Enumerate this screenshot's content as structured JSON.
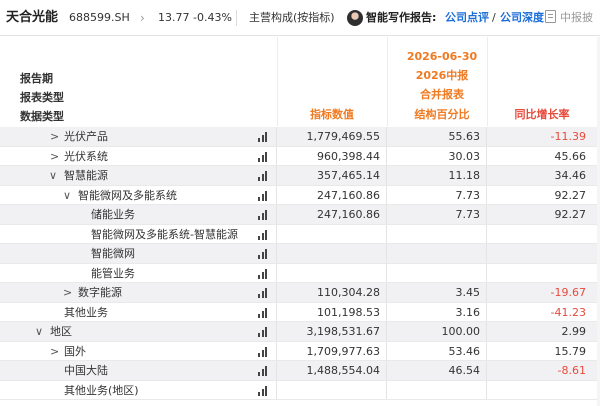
{
  "topbar": {
    "stock_name": "天合光能",
    "stock_code": "688599.SH",
    "chevron": "›",
    "price": "13.77",
    "change": "-0.43%",
    "section": "主营构成(按指标)",
    "ai_label": "智能写作报告:",
    "link1": "公司点评",
    "slash": "/",
    "link2": "公司深度",
    "report": "中报披"
  },
  "header": {
    "labels": [
      "报告期",
      "报表类型",
      "数据类型"
    ],
    "period": "2026-06-30",
    "report_name": "2026中报",
    "report_type": "合并报表",
    "columns": [
      "指标数值",
      "结构百分比",
      "同比增长率"
    ]
  },
  "rows": [
    {
      "label": "光伏产品",
      "chevron": ">",
      "value": "1,779,469.55",
      "pct": "55.63",
      "yoy": "-11.39"
    },
    {
      "label": "光伏系统",
      "chevron": ">",
      "value": "960,398.44",
      "pct": "30.03",
      "yoy": "45.66"
    },
    {
      "label": "智慧能源",
      "chevron": "∨",
      "value": "357,465.14",
      "pct": "11.18",
      "yoy": "34.46"
    },
    {
      "label": "智能微网及多能系统",
      "chevron": "∨",
      "value": "247,160.86",
      "pct": "7.73",
      "yoy": "92.27"
    },
    {
      "label": "储能业务",
      "chevron": "",
      "value": "247,160.86",
      "pct": "7.73",
      "yoy": "92.27"
    },
    {
      "label": "智能微网及多能系统-智慧能源",
      "chevron": "",
      "value": "",
      "pct": "",
      "yoy": ""
    },
    {
      "label": "智能微网",
      "chevron": "",
      "value": "",
      "pct": "",
      "yoy": ""
    },
    {
      "label": "能管业务",
      "chevron": "",
      "value": "",
      "pct": "",
      "yoy": ""
    },
    {
      "label": "数字能源",
      "chevron": ">",
      "value": "110,304.28",
      "pct": "3.45",
      "yoy": "-19.67"
    },
    {
      "label": "其他业务",
      "chevron": "",
      "value": "101,198.53",
      "pct": "3.16",
      "yoy": "-41.23"
    },
    {
      "label": "地区",
      "chevron": "∨",
      "value": "3,198,531.67",
      "pct": "100.00",
      "yoy": "2.99"
    },
    {
      "label": "国外",
      "chevron": ">",
      "value": "1,709,977.63",
      "pct": "53.46",
      "yoy": "15.79"
    },
    {
      "label": "中国大陆",
      "chevron": "",
      "value": "1,488,554.04",
      "pct": "46.54",
      "yoy": "-8.61"
    },
    {
      "label": "其他业务(地区)",
      "chevron": "",
      "value": "",
      "pct": "",
      "yoy": ""
    }
  ],
  "colors": {
    "orange": "#f07a22",
    "red": "#e84a3c",
    "link": "#1a6dd9"
  }
}
